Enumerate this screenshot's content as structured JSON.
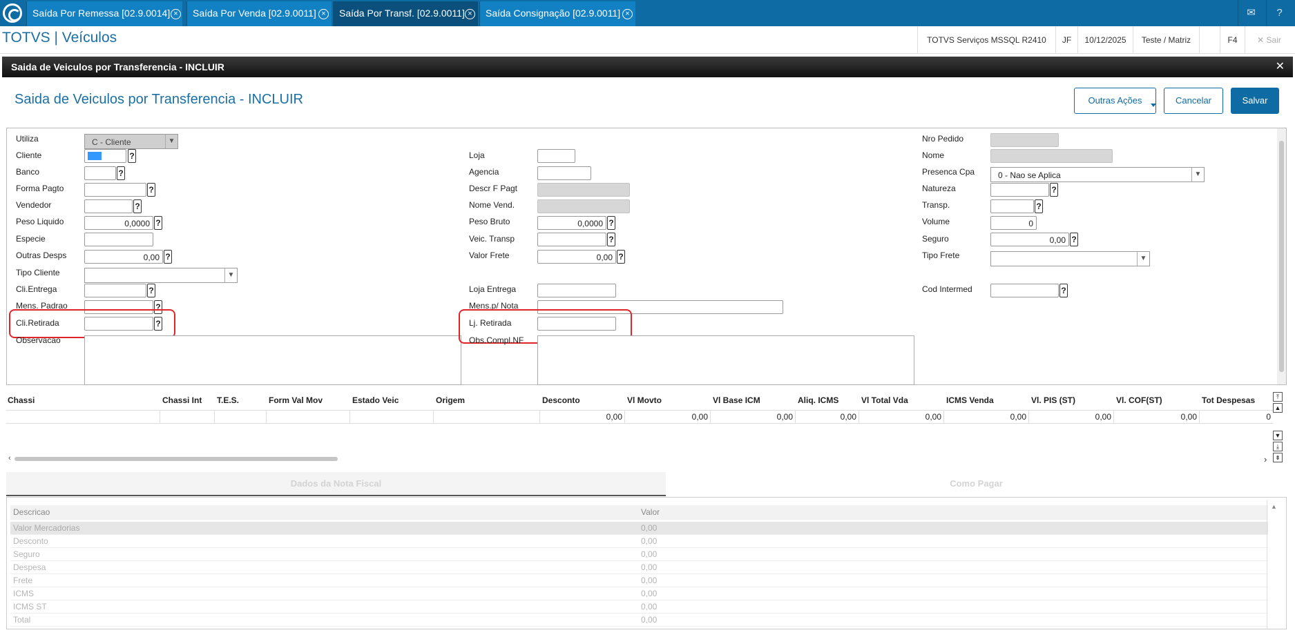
{
  "tabs": [
    {
      "label": "Saída Por Remessa [02.9.0014]"
    },
    {
      "label": "Saída Por Venda [02.9.0011]"
    },
    {
      "label": "Saída Por Transf. [02.9.0011]"
    },
    {
      "label": "Saída Consignação [02.9.0011]"
    }
  ],
  "header": {
    "app_title": "TOTVS | Veículos",
    "env": "TOTVS Serviços MSSQL R2410",
    "user": "JF",
    "date": "10/12/2025",
    "branch": "Teste / Matriz",
    "f4": "F4",
    "exit": "Sair"
  },
  "dialog": {
    "title": "Saida de Veiculos por Transferencia - INCLUIR",
    "form_title": "Saida de Veiculos por Transferencia - INCLUIR"
  },
  "actions": {
    "more": "Outras Ações",
    "cancel": "Cancelar",
    "save": "Salvar"
  },
  "form": {
    "utiliza_label": "Utiliza",
    "utiliza_value": "C - Cliente",
    "cliente_label": "Cliente",
    "banco_label": "Banco",
    "forma_pagto_label": "Forma Pagto",
    "vendedor_label": "Vendedor",
    "peso_liquido_label": "Peso Liquido",
    "peso_liquido_value": "0,0000",
    "especie_label": "Especie",
    "outras_desps_label": "Outras Desps",
    "outras_desps_value": "0,00",
    "tipo_cliente_label": "Tipo Cliente",
    "cli_entrega_label": "Cli.Entrega",
    "mens_padrao_label": "Mens. Padrao",
    "cli_retirada_label": "Cli.Retirada",
    "observacao_label": "Observacao",
    "loja_label": "Loja",
    "agencia_label": "Agencia",
    "descr_f_pagt_label": "Descr F Pagt",
    "nome_vend_label": "Nome Vend.",
    "peso_bruto_label": "Peso Bruto",
    "peso_bruto_value": "0,0000",
    "veic_transp_label": "Veic. Transp",
    "valor_frete_label": "Valor Frete",
    "valor_frete_value": "0,00",
    "loja_entrega_label": "Loja Entrega",
    "mens_nota_label": "Mens.p/ Nota",
    "lj_retirada_label": "Lj. Retirada",
    "obs_compl_label": "Obs.Compl.NF",
    "nro_pedido_label": "Nro Pedido",
    "nome_label": "Nome",
    "presenca_cpa_label": "Presenca Cpa",
    "presenca_cpa_value": "0 - Nao se Aplica",
    "natureza_label": "Natureza",
    "transp_label": "Transp.",
    "volume_label": "Volume",
    "volume_value": "0",
    "seguro_label": "Seguro",
    "seguro_value": "0,00",
    "tipo_frete_label": "Tipo Frete",
    "cod_intermed_label": "Cod Intermed",
    "help": "?"
  },
  "grid": {
    "columns": [
      "Chassi",
      "Chassi Int",
      "T.E.S.",
      "Form Val Mov",
      "Estado Veic",
      "Origem",
      "Desconto",
      "Vl Movto",
      "Vl Base ICM",
      "Aliq. ICMS",
      "Vl Total Vda",
      "ICMS Venda",
      "Vl. PIS (ST)",
      "Vl. COF(ST)",
      "Tot Despesas"
    ],
    "row": [
      "",
      "",
      "",
      "",
      "",
      "",
      "0,00",
      "0,00",
      "0,00",
      "0,00",
      "0,00",
      "0,00",
      "0,00",
      "0,00",
      "0"
    ]
  },
  "bottom_tabs": {
    "nota": "Dados da Nota Fiscal",
    "pagar": "Como Pagar"
  },
  "totals": {
    "header": {
      "desc": "Descricao",
      "val": "Valor"
    },
    "rows": [
      {
        "desc": "Valor Mercadorias",
        "val": "0,00"
      },
      {
        "desc": "Desconto",
        "val": "0,00"
      },
      {
        "desc": "Seguro",
        "val": "0,00"
      },
      {
        "desc": "Despesa",
        "val": "0,00"
      },
      {
        "desc": "Frete",
        "val": "0,00"
      },
      {
        "desc": "ICMS",
        "val": "0,00"
      },
      {
        "desc": "ICMS ST",
        "val": "0,00"
      },
      {
        "desc": "Total",
        "val": "0,00"
      }
    ]
  },
  "colors": {
    "brand": "#0f6ba3",
    "highlight": "#e0252a"
  }
}
